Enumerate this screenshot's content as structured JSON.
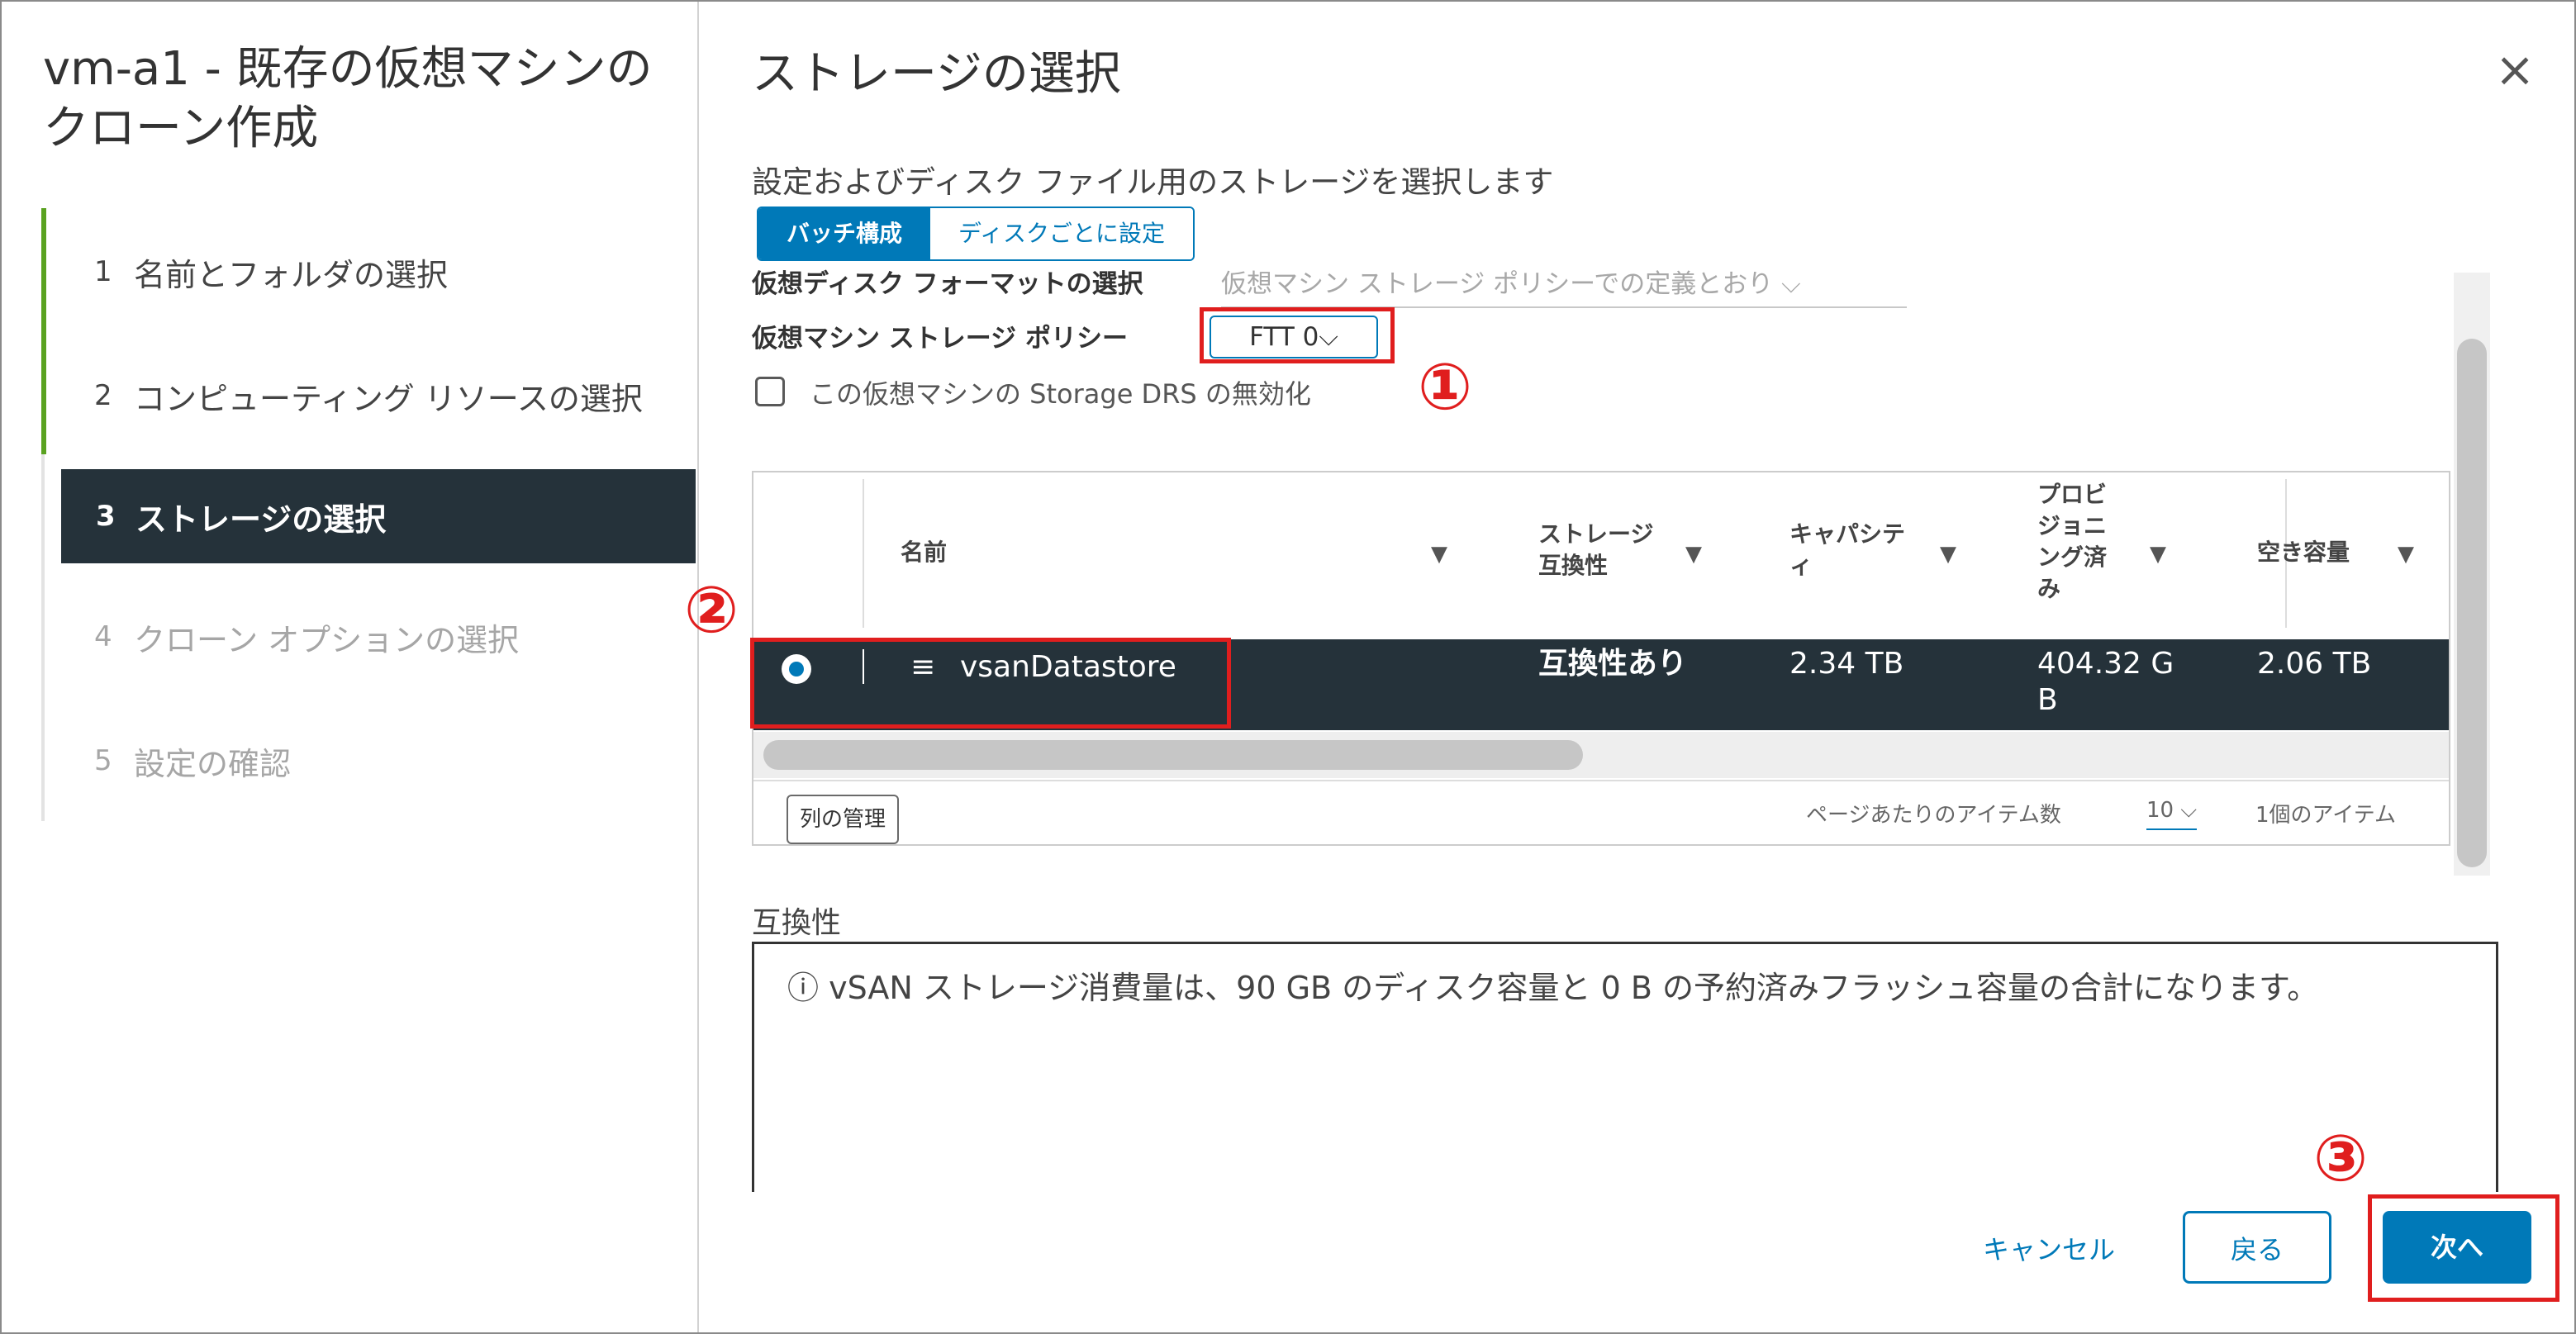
{
  "wizard": {
    "title": "vm-a1 - 既存の仮想マシンのクローン作成",
    "steps": [
      {
        "num": "1",
        "label": "名前とフォルダの選択",
        "state": "done"
      },
      {
        "num": "2",
        "label": "コンピューティング リソースの選択",
        "state": "done"
      },
      {
        "num": "3",
        "label": "ストレージの選択",
        "state": "active"
      },
      {
        "num": "4",
        "label": "クローン オプションの選択",
        "state": "todo"
      },
      {
        "num": "5",
        "label": "設定の確認",
        "state": "todo"
      }
    ]
  },
  "page": {
    "title": "ストレージの選択",
    "close_icon": "×",
    "description": "設定およびディスク ファイル用のストレージを選択します"
  },
  "mode_toggle": {
    "batch": "バッチ構成",
    "per_disk": "ディスクごとに設定",
    "selected": "バッチ構成"
  },
  "disk_format": {
    "label": "仮想ディスク フォーマットの選択",
    "value": "仮想マシン ストレージ ポリシーでの定義とおり ⌵"
  },
  "storage_policy": {
    "label": "仮想マシン ストレージ ポリシー",
    "value": "FTT 0⌵"
  },
  "sdrs": {
    "label": "この仮想マシンの Storage DRS の無効化",
    "checked": false
  },
  "annotations": {
    "one": "①",
    "two": "②",
    "three": "③",
    "color": "#e01e1e"
  },
  "grid": {
    "columns": [
      "名前",
      "ストレージ互換性",
      "キャパシティ",
      "プロビジョニング済み",
      "空き容量"
    ],
    "column_labels": {
      "name": "名前",
      "compat_1": "ストレージ",
      "compat_2": "互換性",
      "cap_1": "キャパシテ",
      "cap_2": "ィ",
      "prov_1": "プロビ",
      "prov_2": "ジョニ",
      "prov_3": "ング済",
      "prov_4": "み",
      "free": "空き容量"
    },
    "filter_icon": "▼",
    "rows": [
      {
        "name": "vsanDatastore",
        "compat": "互換性あり",
        "capacity": "2.34 TB",
        "provisioned_1": "404.32 G",
        "provisioned_2": "B",
        "free": "2.06 TB",
        "selected": true
      }
    ],
    "db_icon": "≡",
    "column_manager": "列の管理",
    "page_size_label": "ページあたりのアイテム数",
    "page_size": "10 ⌵",
    "item_count": "1個のアイテム"
  },
  "compatibility": {
    "label": "互換性",
    "icon": "ⓘ",
    "message": "vSAN ストレージ消費量は、90 GB のディスク容量と 0 B の予約済みフラッシュ容量の合計になります。"
  },
  "buttons": {
    "cancel": "キャンセル",
    "back": "戻る",
    "next": "次へ"
  },
  "colors": {
    "accent": "#0079b8",
    "selected_row": "#25323a",
    "progress": "#5aa220",
    "highlight": "#e01e1e"
  }
}
